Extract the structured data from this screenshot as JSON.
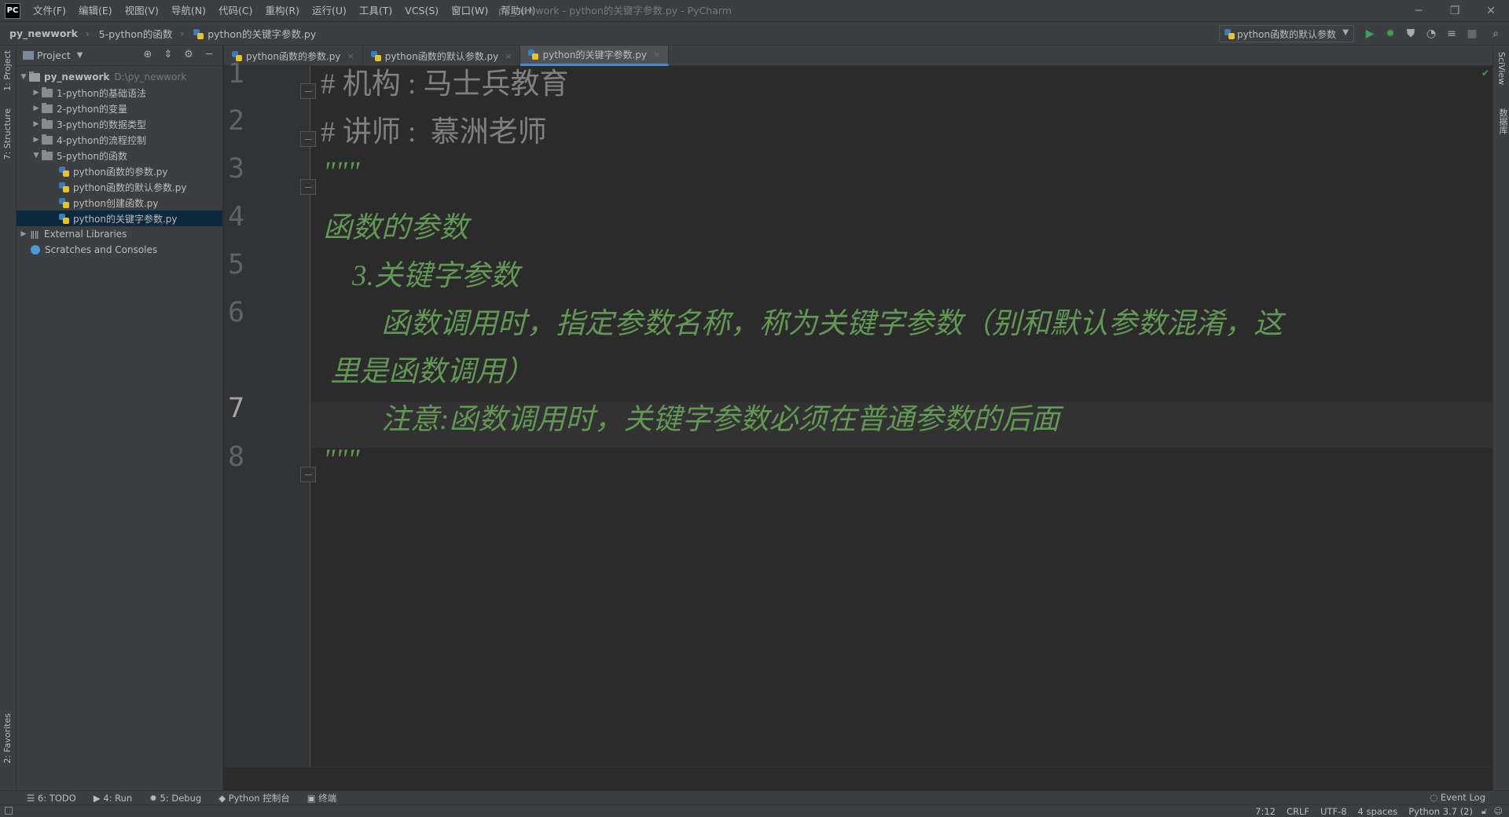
{
  "app": {
    "logo": "PC",
    "window_title": "py_newwork - python的关键字参数.py - PyCharm",
    "menu": [
      "文件(F)",
      "编辑(E)",
      "视图(V)",
      "导航(N)",
      "代码(C)",
      "重构(R)",
      "运行(U)",
      "工具(T)",
      "VCS(S)",
      "窗口(W)",
      "帮助(H)"
    ]
  },
  "navbar": {
    "breadcrumb": [
      "py_newwork",
      "5-python的函数",
      "python的关键字参数.py"
    ],
    "run_config": "python函数的默认参数"
  },
  "left_strip": {
    "project": "1: Project",
    "structure": "7: Structure",
    "favorites": "2: Favorites"
  },
  "right_strip": {
    "sciview": "SciView",
    "database": "数据库"
  },
  "project_panel": {
    "title": "Project",
    "root": {
      "name": "py_newwork",
      "path": "D:\\py_newwork"
    },
    "folders": [
      "1-python的基础语法",
      "2-python的变量",
      "3-python的数据类型",
      "4-python的流程控制",
      "5-python的函数"
    ],
    "files": [
      "python函数的参数.py",
      "python函数的默认参数.py",
      "python创建函数.py",
      "python的关键字参数.py"
    ],
    "external": "External Libraries",
    "scratches": "Scratches and Consoles"
  },
  "tabs": [
    "python函数的参数.py",
    "python函数的默认参数.py",
    "python的关键字参数.py"
  ],
  "editor": {
    "line_numbers": [
      "1",
      "2",
      "3",
      "4",
      "5",
      "6",
      "7",
      "8"
    ],
    "lines": [
      "# 机构 : 马士兵教育",
      "# 讲师 :  慕洲老师",
      "\"\"\"",
      "函数的参数",
      "    3.关键字参数",
      "        函数调用时，指定参数名称，称为关键字参数（别和默认参数混淆，这",
      " 里是函数调用）",
      "        注意:函数调用时，关键字参数必须在普通参数的后面",
      "\"\"\""
    ]
  },
  "bottom_tabs": [
    "6: TODO",
    "4: Run",
    "5: Debug",
    "Python 控制台",
    "终端"
  ],
  "event_log": "Event Log",
  "status": {
    "position": "7:12",
    "line_sep": "CRLF",
    "encoding": "UTF-8",
    "indent": "4 spaces",
    "interpreter": "Python 3.7 (2)"
  },
  "colors": {
    "background": "#2b2b2b",
    "panel": "#3c3f41",
    "comment": "#808080",
    "docstring": "#629755",
    "selection": "#0d293e"
  }
}
